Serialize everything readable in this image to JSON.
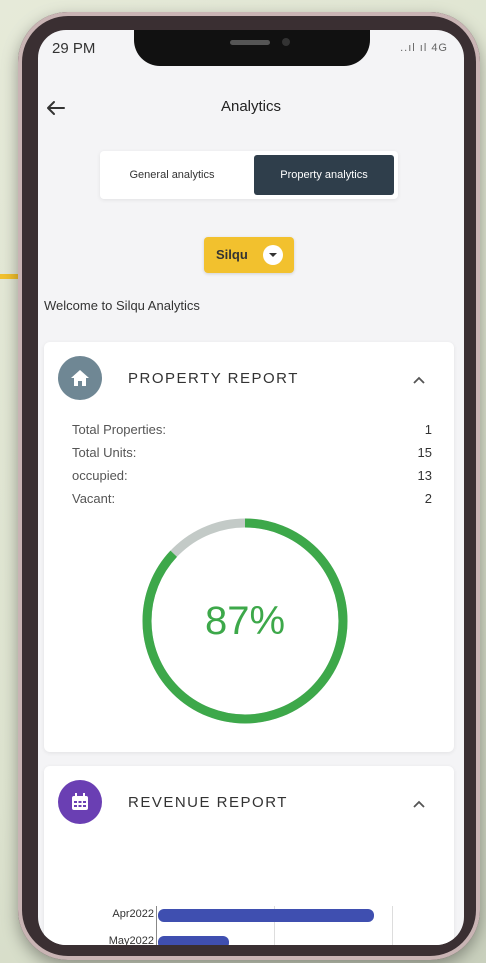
{
  "status": {
    "time": "29 PM",
    "indicators": "..ıl ıl 4G"
  },
  "header": {
    "title": "Analytics"
  },
  "tabs": [
    {
      "label": "General analytics",
      "active": false
    },
    {
      "label": "Property analytics",
      "active": true
    }
  ],
  "property_select": {
    "value": "Silqu"
  },
  "welcome_text": "Welcome to Silqu Analytics",
  "property_report": {
    "title": "PROPERTY REPORT",
    "stats": [
      {
        "label": "Total Properties:",
        "value": "1"
      },
      {
        "label": "Total Units:",
        "value": "15"
      },
      {
        "label": "occupied:",
        "value": "13"
      },
      {
        "label": "Vacant:",
        "value": "2"
      }
    ],
    "occupancy_percent": "87%",
    "occupancy_fraction": 0.87
  },
  "revenue_report": {
    "title": "REVENUE REPORT",
    "chart_data": {
      "type": "bar",
      "orientation": "horizontal",
      "categories": [
        "Apr2022",
        "May2022"
      ],
      "values": [
        1.0,
        0.33
      ]
    }
  },
  "colors": {
    "accent_yellow": "#f2c12e",
    "tab_active": "#2f3e4b",
    "donut_green": "#3da84a",
    "donut_track": "#c3cac7",
    "bar_blue": "#3f4fb0",
    "home_icon_bg": "#6f8794",
    "calendar_icon_bg": "#6a3fb3"
  },
  "icons": {
    "back": "arrow-left-icon",
    "dropdown": "chevron-down-icon",
    "home": "home-icon",
    "calendar": "calendar-icon",
    "collapse": "chevron-up-icon"
  }
}
